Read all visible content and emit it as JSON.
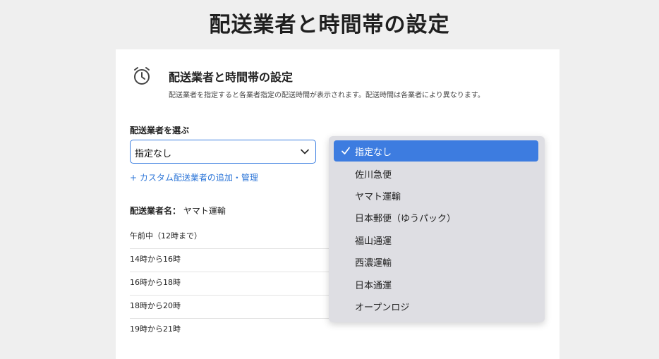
{
  "header": {
    "title": "配送業者と時間帯の設定"
  },
  "card": {
    "title": "配送業者と時間帯の設定",
    "description": "配送業者を指定すると各業者指定の配送時間が表示されます。配送時間は各業者により異なります。",
    "icon": "alarm-clock-icon"
  },
  "carrier_select": {
    "label": "配送業者を選ぶ",
    "value": "指定なし",
    "options": [
      "指定なし",
      "佐川急便",
      "ヤマト運輸",
      "日本郵便（ゆうパック）",
      "福山通運",
      "西濃運輸",
      "日本通運",
      "オープンロジ"
    ],
    "selected_index": 0
  },
  "add_custom_link": "+ カスタム配送業者の追加・管理",
  "carrier_name": {
    "label": "配送業者名：",
    "value": "ヤマト運輸"
  },
  "time_slots": [
    "午前中（12時まで）",
    "14時から16時",
    "16時から18時",
    "18時から20時",
    "19時から21時"
  ],
  "colors": {
    "accent": "#3d7ce0",
    "link": "#2f77d8",
    "page_bg": "#efefef",
    "dropdown_bg": "#dedee3"
  }
}
